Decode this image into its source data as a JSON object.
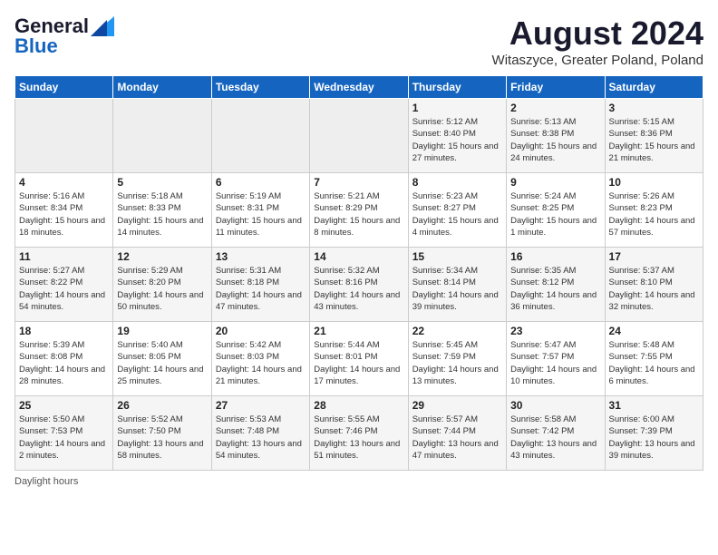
{
  "header": {
    "logo_general": "General",
    "logo_blue": "Blue",
    "month_title": "August 2024",
    "location": "Witaszyce, Greater Poland, Poland"
  },
  "days_of_week": [
    "Sunday",
    "Monday",
    "Tuesday",
    "Wednesday",
    "Thursday",
    "Friday",
    "Saturday"
  ],
  "weeks": [
    [
      {
        "day": "",
        "info": ""
      },
      {
        "day": "",
        "info": ""
      },
      {
        "day": "",
        "info": ""
      },
      {
        "day": "",
        "info": ""
      },
      {
        "day": "1",
        "info": "Sunrise: 5:12 AM\nSunset: 8:40 PM\nDaylight: 15 hours and 27 minutes."
      },
      {
        "day": "2",
        "info": "Sunrise: 5:13 AM\nSunset: 8:38 PM\nDaylight: 15 hours and 24 minutes."
      },
      {
        "day": "3",
        "info": "Sunrise: 5:15 AM\nSunset: 8:36 PM\nDaylight: 15 hours and 21 minutes."
      }
    ],
    [
      {
        "day": "4",
        "info": "Sunrise: 5:16 AM\nSunset: 8:34 PM\nDaylight: 15 hours and 18 minutes."
      },
      {
        "day": "5",
        "info": "Sunrise: 5:18 AM\nSunset: 8:33 PM\nDaylight: 15 hours and 14 minutes."
      },
      {
        "day": "6",
        "info": "Sunrise: 5:19 AM\nSunset: 8:31 PM\nDaylight: 15 hours and 11 minutes."
      },
      {
        "day": "7",
        "info": "Sunrise: 5:21 AM\nSunset: 8:29 PM\nDaylight: 15 hours and 8 minutes."
      },
      {
        "day": "8",
        "info": "Sunrise: 5:23 AM\nSunset: 8:27 PM\nDaylight: 15 hours and 4 minutes."
      },
      {
        "day": "9",
        "info": "Sunrise: 5:24 AM\nSunset: 8:25 PM\nDaylight: 15 hours and 1 minute."
      },
      {
        "day": "10",
        "info": "Sunrise: 5:26 AM\nSunset: 8:23 PM\nDaylight: 14 hours and 57 minutes."
      }
    ],
    [
      {
        "day": "11",
        "info": "Sunrise: 5:27 AM\nSunset: 8:22 PM\nDaylight: 14 hours and 54 minutes."
      },
      {
        "day": "12",
        "info": "Sunrise: 5:29 AM\nSunset: 8:20 PM\nDaylight: 14 hours and 50 minutes."
      },
      {
        "day": "13",
        "info": "Sunrise: 5:31 AM\nSunset: 8:18 PM\nDaylight: 14 hours and 47 minutes."
      },
      {
        "day": "14",
        "info": "Sunrise: 5:32 AM\nSunset: 8:16 PM\nDaylight: 14 hours and 43 minutes."
      },
      {
        "day": "15",
        "info": "Sunrise: 5:34 AM\nSunset: 8:14 PM\nDaylight: 14 hours and 39 minutes."
      },
      {
        "day": "16",
        "info": "Sunrise: 5:35 AM\nSunset: 8:12 PM\nDaylight: 14 hours and 36 minutes."
      },
      {
        "day": "17",
        "info": "Sunrise: 5:37 AM\nSunset: 8:10 PM\nDaylight: 14 hours and 32 minutes."
      }
    ],
    [
      {
        "day": "18",
        "info": "Sunrise: 5:39 AM\nSunset: 8:08 PM\nDaylight: 14 hours and 28 minutes."
      },
      {
        "day": "19",
        "info": "Sunrise: 5:40 AM\nSunset: 8:05 PM\nDaylight: 14 hours and 25 minutes."
      },
      {
        "day": "20",
        "info": "Sunrise: 5:42 AM\nSunset: 8:03 PM\nDaylight: 14 hours and 21 minutes."
      },
      {
        "day": "21",
        "info": "Sunrise: 5:44 AM\nSunset: 8:01 PM\nDaylight: 14 hours and 17 minutes."
      },
      {
        "day": "22",
        "info": "Sunrise: 5:45 AM\nSunset: 7:59 PM\nDaylight: 14 hours and 13 minutes."
      },
      {
        "day": "23",
        "info": "Sunrise: 5:47 AM\nSunset: 7:57 PM\nDaylight: 14 hours and 10 minutes."
      },
      {
        "day": "24",
        "info": "Sunrise: 5:48 AM\nSunset: 7:55 PM\nDaylight: 14 hours and 6 minutes."
      }
    ],
    [
      {
        "day": "25",
        "info": "Sunrise: 5:50 AM\nSunset: 7:53 PM\nDaylight: 14 hours and 2 minutes."
      },
      {
        "day": "26",
        "info": "Sunrise: 5:52 AM\nSunset: 7:50 PM\nDaylight: 13 hours and 58 minutes."
      },
      {
        "day": "27",
        "info": "Sunrise: 5:53 AM\nSunset: 7:48 PM\nDaylight: 13 hours and 54 minutes."
      },
      {
        "day": "28",
        "info": "Sunrise: 5:55 AM\nSunset: 7:46 PM\nDaylight: 13 hours and 51 minutes."
      },
      {
        "day": "29",
        "info": "Sunrise: 5:57 AM\nSunset: 7:44 PM\nDaylight: 13 hours and 47 minutes."
      },
      {
        "day": "30",
        "info": "Sunrise: 5:58 AM\nSunset: 7:42 PM\nDaylight: 13 hours and 43 minutes."
      },
      {
        "day": "31",
        "info": "Sunrise: 6:00 AM\nSunset: 7:39 PM\nDaylight: 13 hours and 39 minutes."
      }
    ]
  ],
  "footer": "Daylight hours"
}
